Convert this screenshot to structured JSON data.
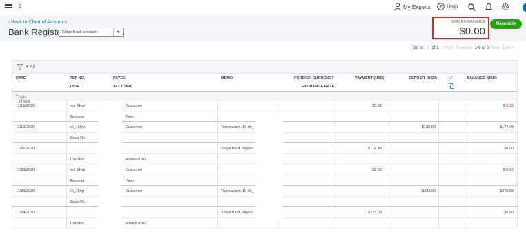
{
  "topbar": {
    "company_initial": "B",
    "my_experts": "My Experts",
    "help": "Help"
  },
  "subheader": {
    "back_link": "Back to Chart of Accounts",
    "title": "Bank Register",
    "account_selected": "Stripe Bank Account",
    "ending_balance_label": "ENDING BALANCE",
    "ending_balance_value": "$0.00",
    "reconcile_label": "Reconcile"
  },
  "pager": {
    "goto_label": "Go to:",
    "page_value": "1",
    "of_label": "of 1",
    "first": "< First",
    "previous": "Previous",
    "range": "1-6 of 6",
    "next": "Next",
    "last": "Last >"
  },
  "toolbar": {
    "filter_all": "All"
  },
  "columns": {
    "date": "DATE",
    "ref_no": "REF NO.",
    "type": "TYPE",
    "payee": "PAYEE",
    "account": "ACCOUNT",
    "memo": "MEMO",
    "foreign_currency": "FOREIGN CURRENCY",
    "exchange_rate": "EXCHANGE RATE",
    "payment": "PAYMENT (USD)",
    "deposit": "DEPOSIT (USD)",
    "cleared": "✓",
    "balance": "BALANCE (USD)"
  },
  "add_check_label": "Add check",
  "rows": [
    {
      "date": "11/19/2020",
      "ref": "txn_1Hpl",
      "type": "Expense",
      "payee": "Customer",
      "account": "Fees",
      "memo": "",
      "payment": "$5.52",
      "deposit": "",
      "balance": "$-5.52",
      "balance_negative": true
    },
    {
      "date": "11/19/2020",
      "ref": "ch_1HpA",
      "type": "Sales Re",
      "payee": "Customer",
      "account": "",
      "memo": "Transaction ID: ch_",
      "payment": "",
      "deposit": "$180.00",
      "balance": "$174.48",
      "balance_negative": false
    },
    {
      "date": "11/22/2020",
      "ref": "",
      "type": "Transfer",
      "payee": "",
      "account": "erwise USD",
      "memo": "Stripe Bank Payout",
      "payment": "$174.48",
      "deposit": "",
      "balance": "$0.00",
      "balance_negative": false
    },
    {
      "date": "11/23/2020",
      "ref": "txn_1Hql",
      "type": "Expense",
      "payee": "Customer",
      "account": "Fees",
      "memo": "",
      "payment": "$8.52",
      "deposit": "",
      "balance": "$-8.52",
      "balance_negative": true
    },
    {
      "date": "11/23/2020",
      "ref": "ch_1Hql",
      "type": "Sales Re",
      "payee": "Customer",
      "account": "",
      "memo": "Transaction ID: ch_",
      "payment": "",
      "deposit": "$283.60",
      "balance": "$275.08",
      "balance_negative": false
    },
    {
      "date": "11/24/2020",
      "ref": "",
      "type": "Transfer",
      "payee": "",
      "account": "erwise USD",
      "memo": "Stripe Bank Payout",
      "payment": "$275.08",
      "deposit": "",
      "balance": "$0.00",
      "balance_negative": false
    }
  ],
  "colors": {
    "accent_green": "#2ca01c",
    "link_blue": "#0077c5",
    "negative_red": "#d52b1e",
    "highlight_red": "#d52b1e"
  }
}
